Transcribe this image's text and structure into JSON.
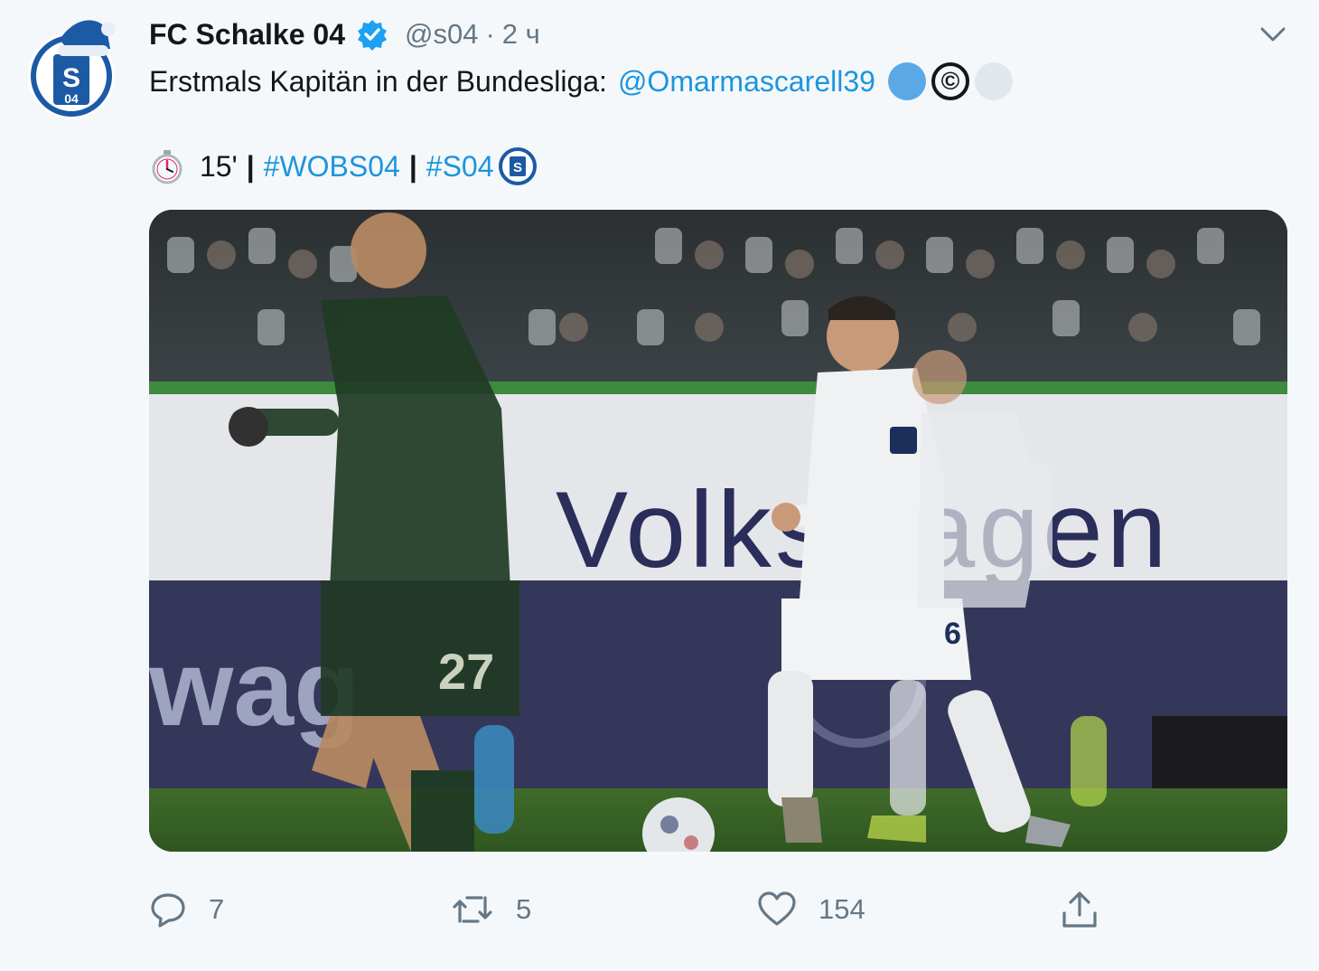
{
  "tweet": {
    "author": {
      "display_name": "FC Schalke 04",
      "handle": "@s04",
      "separator": "·",
      "time": "2 ч",
      "avatar_icon": "schalke-logo-santa-hat",
      "verified_icon": "verified-badge-icon"
    },
    "text": {
      "line1_prefix": "Erstmals Kapitän in der Bundesliga:",
      "mention": "@Omarmascarell39",
      "emoji_blue": "blue-circle-emoji",
      "emoji_copyright": "©",
      "emoji_grey": "white-circle-emoji",
      "stopwatch_icon": "stopwatch-icon",
      "minute": "15'",
      "separator": "|",
      "hashtag1": "#WOBS04",
      "hashtag2": "#S04",
      "club_emoji": "schalke-emoji-icon"
    },
    "media": {
      "type": "photo",
      "alt_icon": "match-photo"
    },
    "actions": {
      "reply_count": "7",
      "retweet_count": "5",
      "like_count": "154"
    }
  },
  "colors": {
    "background": "#f5f8fa",
    "link": "#1b95e0",
    "muted": "#657786",
    "verified": "#1da1f2",
    "schalke_blue": "#1c5aa6"
  }
}
